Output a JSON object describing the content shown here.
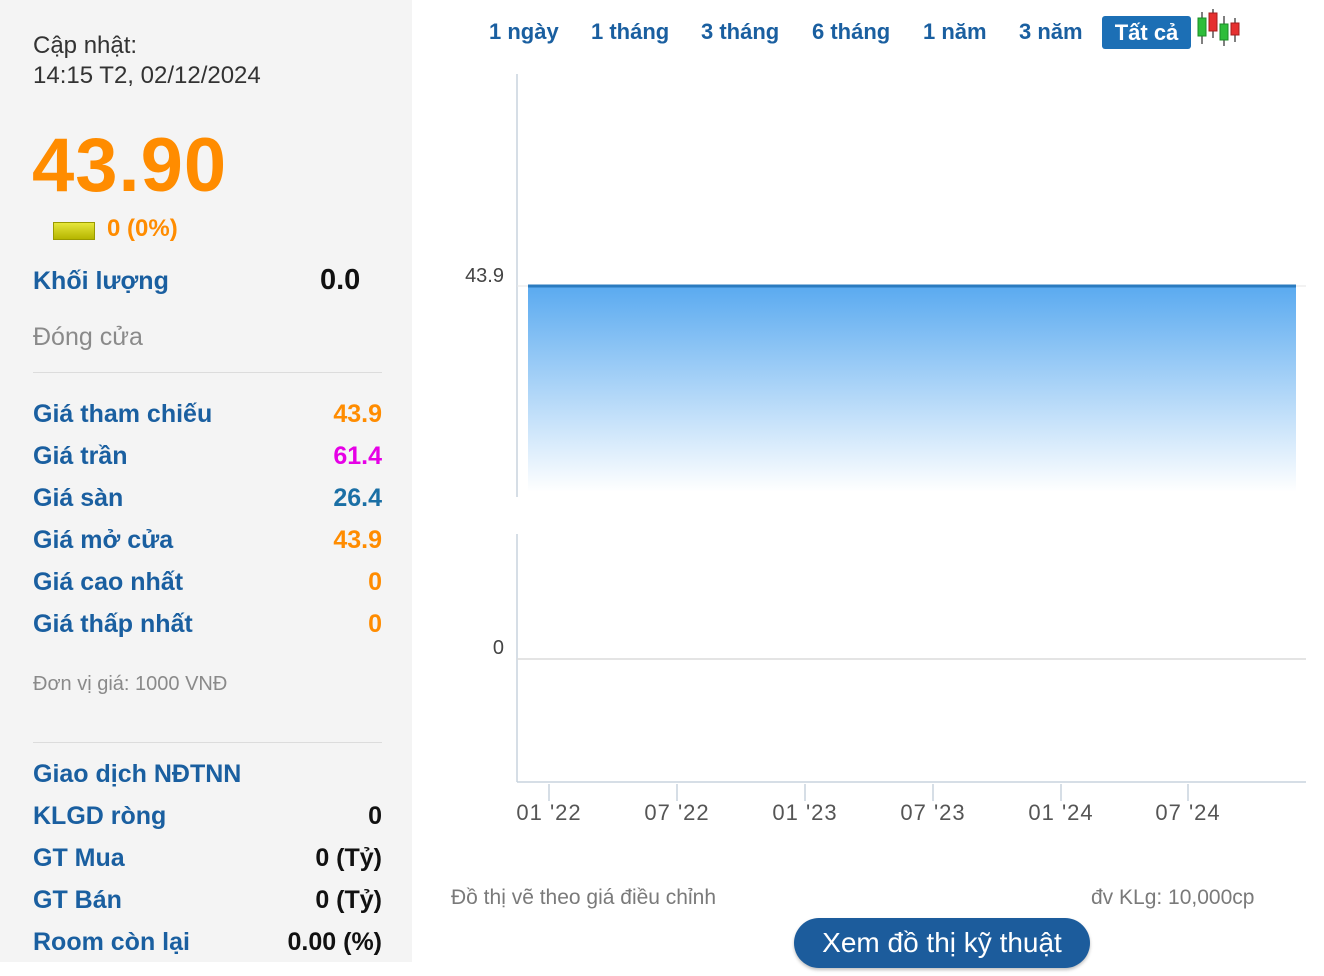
{
  "update": {
    "label": "Cập nhật:",
    "time": "14:15 T2, 02/12/2024"
  },
  "price": {
    "value": "43.90",
    "change": "0 (0%)"
  },
  "volume": {
    "label": "Khối lượng",
    "value": "0.0"
  },
  "session_status": "Đóng cửa",
  "stats": [
    {
      "label": "Giá tham chiếu",
      "value": "43.9",
      "color": "#ff8c00"
    },
    {
      "label": "Giá trần",
      "value": "61.4",
      "color": "#e600e6"
    },
    {
      "label": "Giá sàn",
      "value": "26.4",
      "color": "#1a6fa5"
    },
    {
      "label": "Giá mở cửa",
      "value": "43.9",
      "color": "#ff8c00"
    },
    {
      "label": "Giá cao nhất",
      "value": "0",
      "color": "#ff8c00"
    },
    {
      "label": "Giá thấp nhất",
      "value": "0",
      "color": "#ff8c00"
    }
  ],
  "price_unit": "Đơn vị giá: 1000 VNĐ",
  "foreign": {
    "title": "Giao dịch NĐTNN",
    "rows": [
      {
        "label": "KLGD ròng",
        "value": "0"
      },
      {
        "label": "GT Mua",
        "value": "0 (Tỷ)"
      },
      {
        "label": "GT Bán",
        "value": "0 (Tỷ)"
      },
      {
        "label": "Room còn lại",
        "value": "0.00 (%)"
      }
    ]
  },
  "tabs": [
    "1 ngày",
    "1 tháng",
    "3 tháng",
    "6 tháng",
    "1 năm",
    "3 năm"
  ],
  "active_tab": "Tất cả",
  "icons": {
    "chart_type": "candlestick-icon"
  },
  "colors": {
    "line": "#2b7bbf",
    "fill_top": "#5aaaf0",
    "label_blue": "#1a5fa0",
    "button": "#1c5c9c"
  },
  "chart_data": {
    "type": "area",
    "x": [
      "01 '22",
      "07 '22",
      "01 '23",
      "07 '23",
      "01 '24",
      "07 '24"
    ],
    "series": [
      {
        "values": [
          43.9,
          43.9,
          43.9,
          43.9,
          43.9,
          43.9
        ]
      }
    ],
    "y_ticks": [
      "43.9",
      "0"
    ]
  },
  "footer": {
    "note": "Đồ thị vẽ theo giá điều chỉnh",
    "volume_unit": "đv KLg: 10,000cp",
    "tech_button": "Xem đồ thị kỹ thuật"
  }
}
